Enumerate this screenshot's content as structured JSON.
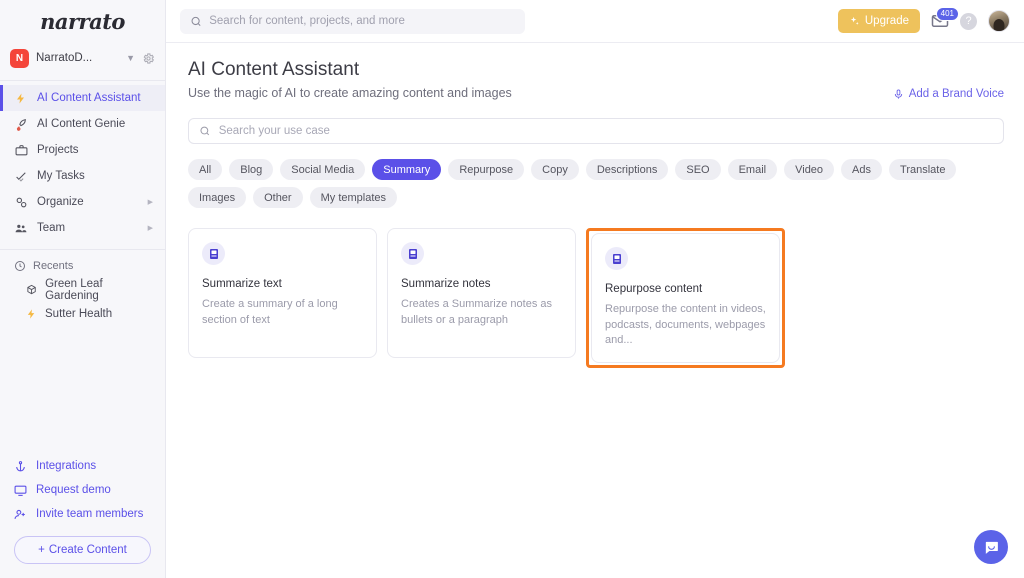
{
  "sidebar": {
    "logo": "narrato",
    "workspace": {
      "initial": "N",
      "name": "NarratoD...",
      "caret_icon": "chevron-down-icon",
      "settings_icon": "gear-icon"
    },
    "nav": [
      {
        "label": "AI Content Assistant",
        "icon": "lightning-bolt-icon",
        "active": true
      },
      {
        "label": "AI Content Genie",
        "icon": "rocket-icon",
        "active": false
      },
      {
        "label": "Projects",
        "icon": "briefcase-icon",
        "active": false
      },
      {
        "label": "My Tasks",
        "icon": "check-icon",
        "active": false
      },
      {
        "label": "Organize",
        "icon": "gears-icon",
        "active": false,
        "arrow": "▶"
      },
      {
        "label": "Team",
        "icon": "people-icon",
        "active": false,
        "arrow": "▶"
      }
    ],
    "recents": {
      "label": "Recents",
      "icon": "clock-icon",
      "items": [
        {
          "label": "Green Leaf Gardening",
          "icon": "cube-icon"
        },
        {
          "label": "Sutter Health",
          "icon": "lightning-bolt-icon"
        }
      ]
    },
    "bottom": [
      {
        "label": "Integrations",
        "icon": "anchor-icon"
      },
      {
        "label": "Request demo",
        "icon": "monitor-icon"
      },
      {
        "label": "Invite team members",
        "icon": "user-plus-icon"
      }
    ],
    "create_button": {
      "label": "Create Content",
      "plus": "+"
    }
  },
  "topbar": {
    "search": {
      "placeholder": "Search for content, projects, and more",
      "value": "",
      "icon": "search-icon"
    },
    "upgrade": {
      "label": "Upgrade",
      "icon": "sparkle-icon"
    },
    "mail": {
      "icon": "envelope-icon",
      "badge": "401"
    },
    "help": {
      "icon": "question-mark-icon",
      "glyph": "?"
    },
    "avatar": {
      "icon": "avatar"
    }
  },
  "page": {
    "title": "AI Content Assistant",
    "subtitle": "Use the magic of AI to create amazing content and images",
    "brand_voice": {
      "label": "Add a Brand Voice",
      "icon": "microphone-icon"
    },
    "usecase_search": {
      "placeholder": "Search your use case",
      "value": "",
      "icon": "search-icon"
    }
  },
  "filters": [
    {
      "label": "All",
      "active": false
    },
    {
      "label": "Blog",
      "active": false
    },
    {
      "label": "Social Media",
      "active": false
    },
    {
      "label": "Summary",
      "active": true
    },
    {
      "label": "Repurpose",
      "active": false
    },
    {
      "label": "Copy",
      "active": false
    },
    {
      "label": "Descriptions",
      "active": false
    },
    {
      "label": "SEO",
      "active": false
    },
    {
      "label": "Email",
      "active": false
    },
    {
      "label": "Video",
      "active": false
    },
    {
      "label": "Ads",
      "active": false
    },
    {
      "label": "Translate",
      "active": false
    },
    {
      "label": "Images",
      "active": false
    },
    {
      "label": "Other",
      "active": false
    },
    {
      "label": "My templates",
      "active": false
    }
  ],
  "cards": [
    {
      "title": "Summarize text",
      "desc": "Create a summary of a long section of text",
      "icon": "book-icon",
      "highlighted": false
    },
    {
      "title": "Summarize notes",
      "desc": "Creates a Summarize notes as bullets or a paragraph",
      "icon": "book-icon",
      "highlighted": false
    },
    {
      "title": "Repurpose content",
      "desc": "Repurpose the content in videos, podcasts, documents, webpages and...",
      "icon": "book-icon",
      "highlighted": true
    }
  ],
  "chat_widget": {
    "icon": "chat-bubble-icon"
  },
  "colors": {
    "accent": "#5b50e8",
    "highlight": "#f57a20",
    "upgrade": "#eec25c",
    "badge": "#5b63e8",
    "sidebar_bg": "#f7f7fa"
  }
}
